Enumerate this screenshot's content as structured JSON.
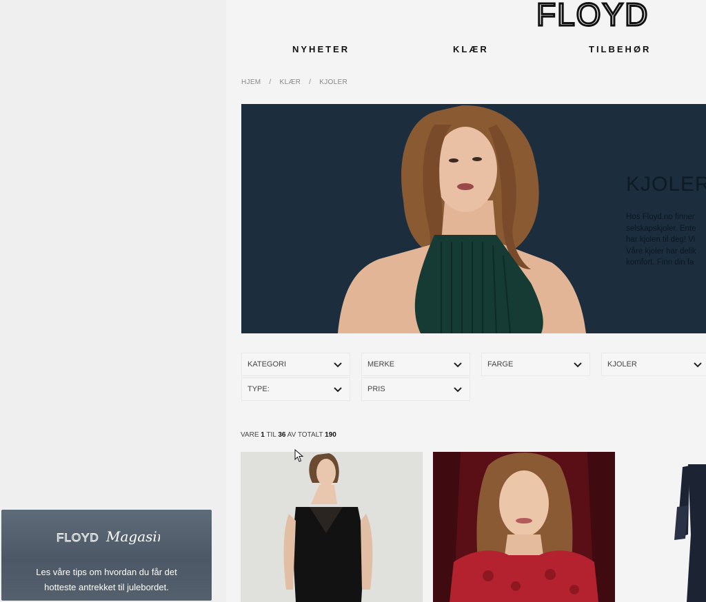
{
  "brand": {
    "logo_text": "FLOYD"
  },
  "nav": {
    "items": [
      "NYHETER",
      "KLÆR",
      "TILBEHØR"
    ]
  },
  "breadcrumb": {
    "items": [
      "HJEM",
      "KLÆR",
      "KJOLER"
    ],
    "separator": "/"
  },
  "hero": {
    "title": "KJOLER",
    "text_lines": [
      "Hos Floyd.no finner",
      "selskapskjoler. Ente",
      "har kjolen til deg! Vi",
      "Våre kjoler har delik",
      "komfort. Finn din fa"
    ]
  },
  "filters": [
    {
      "label": "KATEGORI"
    },
    {
      "label": "MERKE"
    },
    {
      "label": "FARGE"
    },
    {
      "label": "KJOLER"
    },
    {
      "label": "TYPE:"
    },
    {
      "label": "PRIS"
    }
  ],
  "count": {
    "prefix": "VARE",
    "from": "1",
    "til_word": "TIL",
    "to": "36",
    "total_word": "AV TOTALT",
    "total": "190"
  },
  "magazine": {
    "logo_text": "FLOYD",
    "logo_script": "Magasin",
    "line1": "Les våre tips om hvordan du får det",
    "line2": "hotteste antrekket til julebordet."
  },
  "colors": {
    "hero_bg": "#1c2e3d",
    "magazine_bg": "#55606d",
    "dress_green": "#163a34"
  }
}
